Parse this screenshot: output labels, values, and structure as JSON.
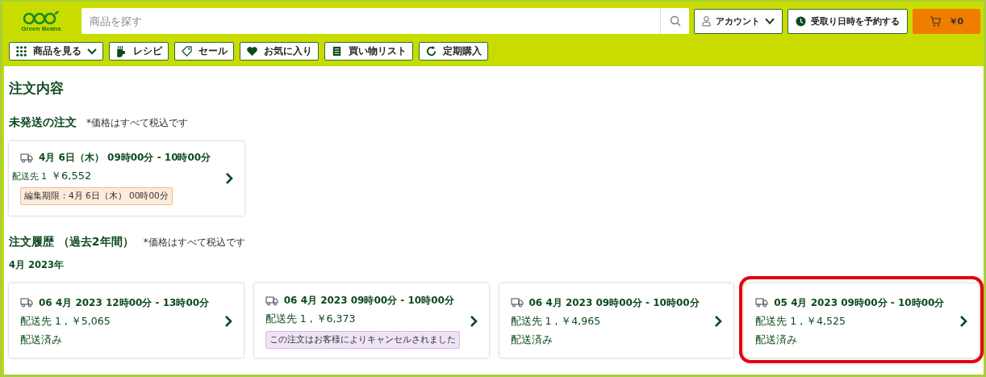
{
  "header": {
    "logo_text": "Green Beans",
    "search": {
      "placeholder": "商品を探す"
    },
    "account_button": "アカウント",
    "reserve_button": "受取り日時を予約する",
    "cart_button": "￥0"
  },
  "nav": [
    {
      "label": "商品を見る",
      "has_menu": true
    },
    {
      "label": "レシピ",
      "has_menu": false
    },
    {
      "label": "セール",
      "has_menu": false
    },
    {
      "label": "お気に入り",
      "has_menu": false
    },
    {
      "label": "買い物リスト",
      "has_menu": false
    },
    {
      "label": "定期購入",
      "has_menu": false
    }
  ],
  "page_title": "注文内容",
  "pending": {
    "heading": "未発送の注文",
    "note": "*価格はすべて税込です",
    "orders": [
      {
        "title": "4月 6日（木） 09時00分 - 10時00分",
        "destination": "配送先 1",
        "price": "￥6,552",
        "deadline": "編集期限：4月 6日（木） 00時00分"
      }
    ]
  },
  "history": {
    "heading": "注文履歴 （過去2年間）",
    "note": "*価格はすべて税込です",
    "month": "4月 2023年",
    "orders": [
      {
        "title": "06 4月 2023 12時00分 - 13時00分",
        "summary": "配送先 1 , ￥5,065",
        "kind": "delivered",
        "status": "配送済み",
        "highlighted": false
      },
      {
        "title": "06 4月 2023 09時00分 - 10時00分",
        "summary": "配送先 1 , ￥6,373",
        "kind": "cancelled",
        "status": "この注文はお客様によりキャンセルされました",
        "highlighted": false
      },
      {
        "title": "06 4月 2023 09時00分 - 10時00分",
        "summary": "配送先 1 , ￥4,965",
        "kind": "delivered",
        "status": "配送済み",
        "highlighted": false
      },
      {
        "title": "05 4月 2023 09時00分 - 10時00分",
        "summary": "配送先 1 , ￥4,525",
        "kind": "delivered",
        "status": "配送済み",
        "highlighted": true
      }
    ]
  }
}
